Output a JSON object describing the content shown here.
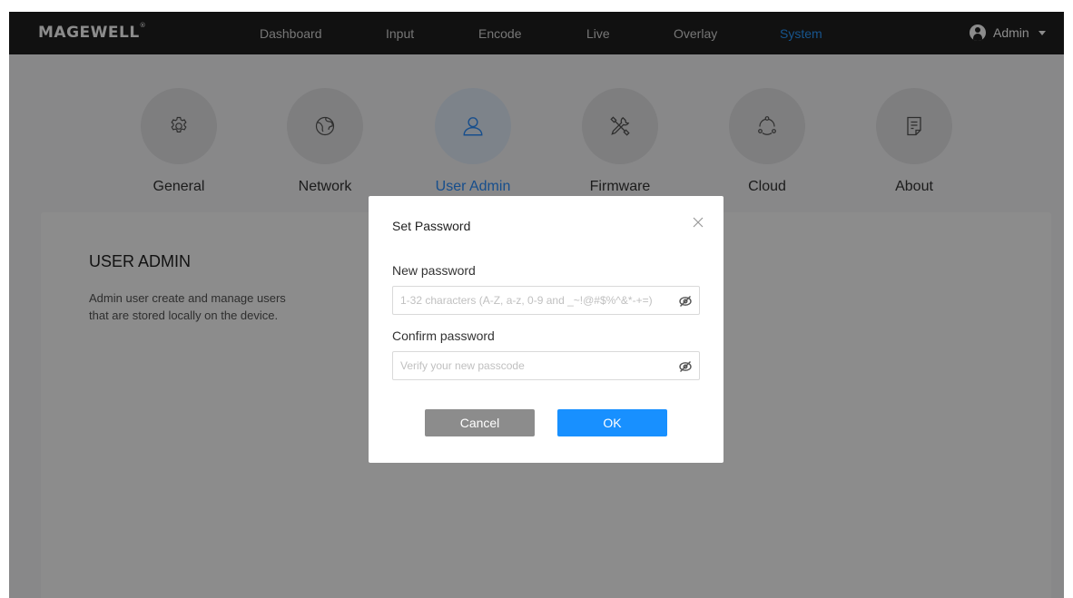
{
  "brand": {
    "logo_text": "MAGEWELL",
    "registered_mark": "®"
  },
  "nav": {
    "items": [
      {
        "label": "Dashboard"
      },
      {
        "label": "Input"
      },
      {
        "label": "Encode"
      },
      {
        "label": "Live"
      },
      {
        "label": "Overlay"
      },
      {
        "label": "System",
        "active": true
      }
    ],
    "user": {
      "label": "Admin",
      "icon": "user-avatar-icon"
    }
  },
  "system_tiles": [
    {
      "label": "General",
      "icon": "gear-icon"
    },
    {
      "label": "Network",
      "icon": "globe-icon"
    },
    {
      "label": "User Admin",
      "icon": "user-icon",
      "active": true
    },
    {
      "label": "Firmware",
      "icon": "tools-icon"
    },
    {
      "label": "Cloud",
      "icon": "cloud-nodes-icon"
    },
    {
      "label": "About",
      "icon": "document-icon"
    }
  ],
  "section": {
    "title": "USER ADMIN",
    "description": "Admin user create and manage users that are stored locally on the device."
  },
  "dialog": {
    "title": "Set Password",
    "new_password": {
      "label": "New password",
      "placeholder": "1-32 characters (A-Z, a-z, 0-9 and _~!@#$%^&*-+=)",
      "value": ""
    },
    "confirm_password": {
      "label": "Confirm password",
      "placeholder": "Verify your new passcode",
      "value": ""
    },
    "cancel_label": "Cancel",
    "ok_label": "OK"
  },
  "colors": {
    "accent": "#1890ff",
    "nav_background": "#1f1f1f",
    "cancel_button": "#8c8c8c"
  }
}
